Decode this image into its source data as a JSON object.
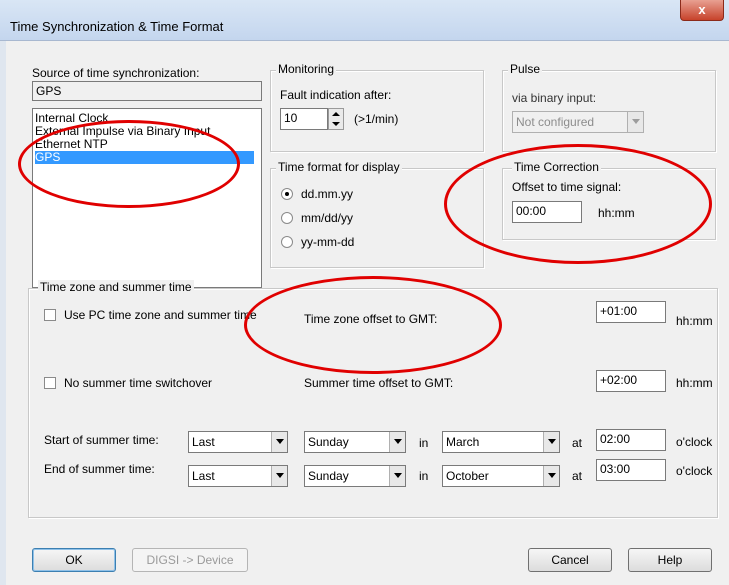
{
  "window": {
    "title": "Time Synchronization & Time Format",
    "close_glyph": "x"
  },
  "source": {
    "label": "Source of time synchronization:",
    "value": "GPS",
    "options": [
      "Internal Clock",
      "External Impulse via Binary Input",
      "Ethernet NTP",
      "GPS"
    ],
    "selected_index": 3
  },
  "monitoring": {
    "legend": "Monitoring",
    "fault_label": "Fault indication after:",
    "fault_value": "10",
    "unit": "(>1/min)"
  },
  "pulse": {
    "legend": "Pulse",
    "via_label": "via binary input:",
    "select_value": "Not configured"
  },
  "time_format": {
    "legend": "Time format for display",
    "options": [
      "dd.mm.yy",
      "mm/dd/yy",
      "yy-mm-dd"
    ],
    "selected_index": 0
  },
  "time_correction": {
    "legend": "Time Correction",
    "offset_label": "Offset to time signal:",
    "offset_value": "00:00",
    "unit": "hh:mm"
  },
  "timezone": {
    "legend": "Time zone and summer time",
    "use_pc_label": "Use PC time zone and summer time",
    "use_pc_checked": false,
    "tz_offset_label": "Time zone offset to GMT:",
    "tz_offset_value": "+01:00",
    "no_switch_label": "No summer time switchover",
    "no_switch_checked": false,
    "summer_offset_label": "Summer time offset to GMT:",
    "summer_offset_value": "+02:00",
    "unit": "hh:mm",
    "start": {
      "label": "Start of summer time:",
      "week": "Last",
      "day": "Sunday",
      "in_label": "in",
      "month": "March",
      "at_label": "at",
      "time": "02:00",
      "oclock": "o'clock"
    },
    "end": {
      "label": "End of summer time:",
      "week": "Last",
      "day": "Sunday",
      "in_label": "in",
      "month": "October",
      "at_label": "at",
      "time": "03:00",
      "oclock": "o'clock"
    }
  },
  "buttons": {
    "ok": "OK",
    "digsi": "DIGSI -> Device",
    "cancel": "Cancel",
    "help": "Help"
  },
  "colors": {
    "highlight": "#3399ff",
    "annotation": "#e00000"
  }
}
